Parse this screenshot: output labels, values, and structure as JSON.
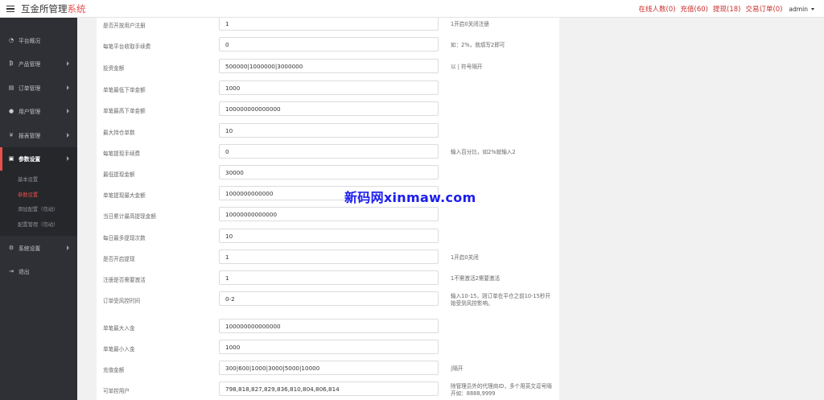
{
  "header": {
    "title": "互金所管理",
    "title_accent": "系统",
    "links": {
      "online": "在线人数(0)",
      "recharge": "充值(60)",
      "withdraw": "提现(18)",
      "orders": "交易订单(0)"
    },
    "user": "admin"
  },
  "sidebar": {
    "items": [
      {
        "label": "平台概况",
        "icon": "dashboard-icon"
      },
      {
        "label": "产品管理",
        "icon": "bitcoin-icon"
      },
      {
        "label": "订单管理",
        "icon": "document-icon"
      },
      {
        "label": "用户管理",
        "icon": "user-icon"
      },
      {
        "label": "报表管理",
        "icon": "yen-icon"
      },
      {
        "label": "参数设置",
        "icon": "briefcase-icon"
      },
      {
        "label": "系统设置",
        "icon": "gears-icon"
      },
      {
        "label": "退出",
        "icon": "logout-icon"
      }
    ],
    "submenu": [
      "基本设置",
      "参数设置",
      "添加配置（勿动）",
      "配置管理（勿动）"
    ]
  },
  "form": {
    "rows": [
      {
        "label": "是否开放用户注册",
        "value": "1",
        "hint": "1开启0关闭注册"
      },
      {
        "label": "每笔平台收取手续费",
        "value": "0",
        "hint": "如：2%，就填写2即可"
      },
      {
        "label": "投资金额",
        "value": "500000|1000000|3000000",
        "hint": "以 | 符号隔开"
      },
      {
        "label": "单笔最低下单金额",
        "value": "1000",
        "hint": ""
      },
      {
        "label": "单笔最高下单金额",
        "value": "100000000000000",
        "hint": ""
      },
      {
        "label": "最大持仓单数",
        "value": "10",
        "hint": ""
      },
      {
        "label": "每笔提现手续费",
        "value": "0",
        "hint": "输入百分比，如2%就输入2"
      },
      {
        "label": "最低提现金额",
        "value": "30000",
        "hint": ""
      },
      {
        "label": "单笔提现最大金额",
        "value": "1000000000000",
        "hint": ""
      },
      {
        "label": "当日累计最高提现金额",
        "value": "10000000000000",
        "hint": ""
      },
      {
        "label": "每日最多提现次数",
        "value": "10",
        "hint": ""
      },
      {
        "label": "是否开启提现",
        "value": "1",
        "hint": "1开启0关闭"
      },
      {
        "label": "注册是否需要激活",
        "value": "1",
        "hint": "1不需激活2需要激活"
      },
      {
        "label": "订单受风控时间",
        "value": "0-2",
        "hint": "输入10-15，则订单在平仓之前10-15秒开始受到风控影响。"
      },
      {
        "label": "单笔最大入金",
        "value": "100000000000000",
        "hint": ""
      },
      {
        "label": "单笔最小入金",
        "value": "1000",
        "hint": ""
      },
      {
        "label": "充值金额",
        "value": "300|600|1000|3000|5000|10000",
        "hint": "|隔开"
      },
      {
        "label": "可单控用户",
        "value": "798,818,827,829,836,810,804,806,814",
        "hint": "除管理员外的代理商ID，多个用英文逗号隔开如：8888,9999"
      }
    ]
  },
  "watermark": "新码网xinmaw.com"
}
